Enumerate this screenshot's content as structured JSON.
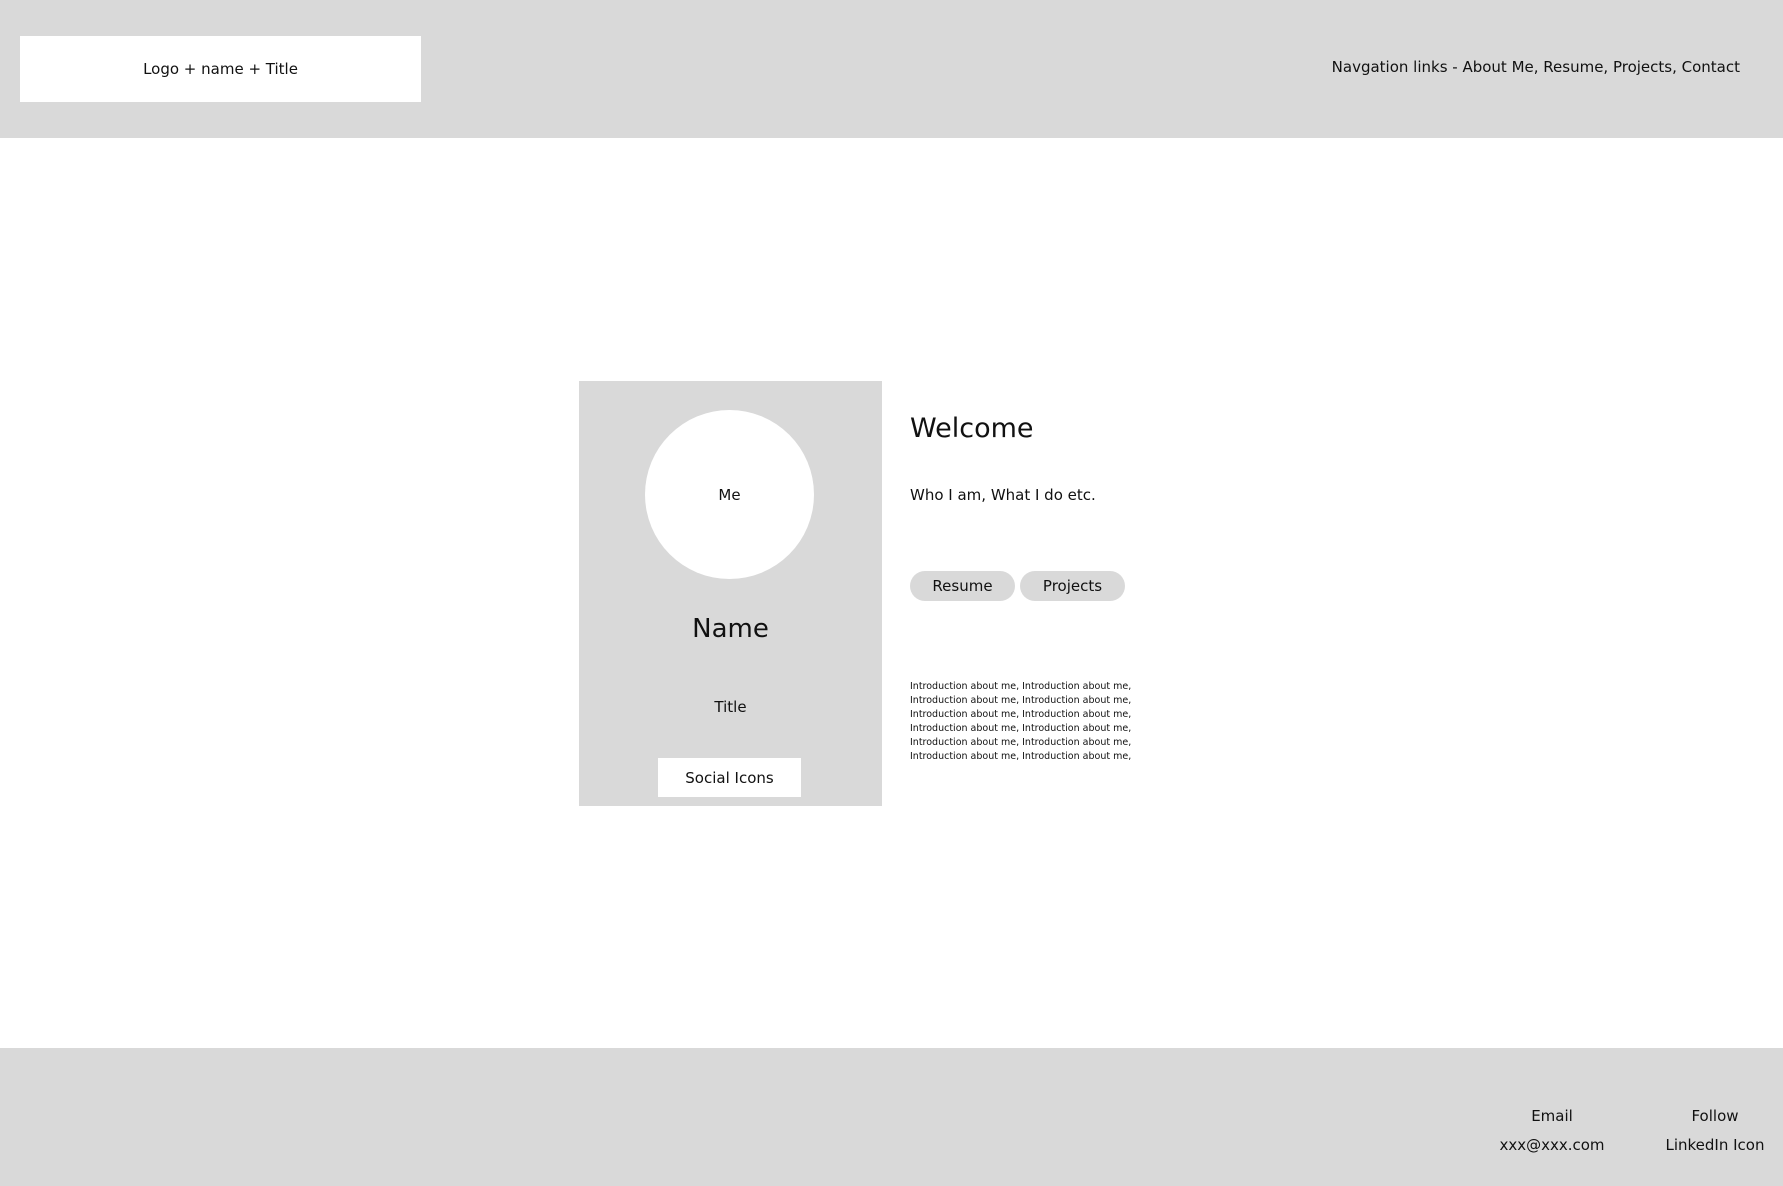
{
  "header": {
    "logo_text": "Logo + name + Title",
    "nav_text": "Navgation links -  About Me, Resume, Projects, Contact"
  },
  "profile": {
    "avatar_text": "Me",
    "name": "Name",
    "title": "Title",
    "social_text": "Social Icons"
  },
  "main": {
    "heading": "Welcome",
    "tagline": "Who I am, What I do etc.",
    "buttons": [
      {
        "label": "Resume"
      },
      {
        "label": "Projects"
      }
    ],
    "intro": "Introduction about me, Introduction about me, Introduction about me, Introduction about me, Introduction about me, Introduction about me, Introduction about me, Introduction about me, Introduction about me, Introduction about me, Introduction about me, Introduction about me,"
  },
  "footer": {
    "email_label": "Email",
    "email_value": "xxx@xxx.com",
    "follow_label": "Follow",
    "follow_value": "LinkedIn Icon"
  },
  "colors": {
    "panel_gray": "#d9d9d9",
    "background": "#ffffff",
    "text": "#111111"
  }
}
